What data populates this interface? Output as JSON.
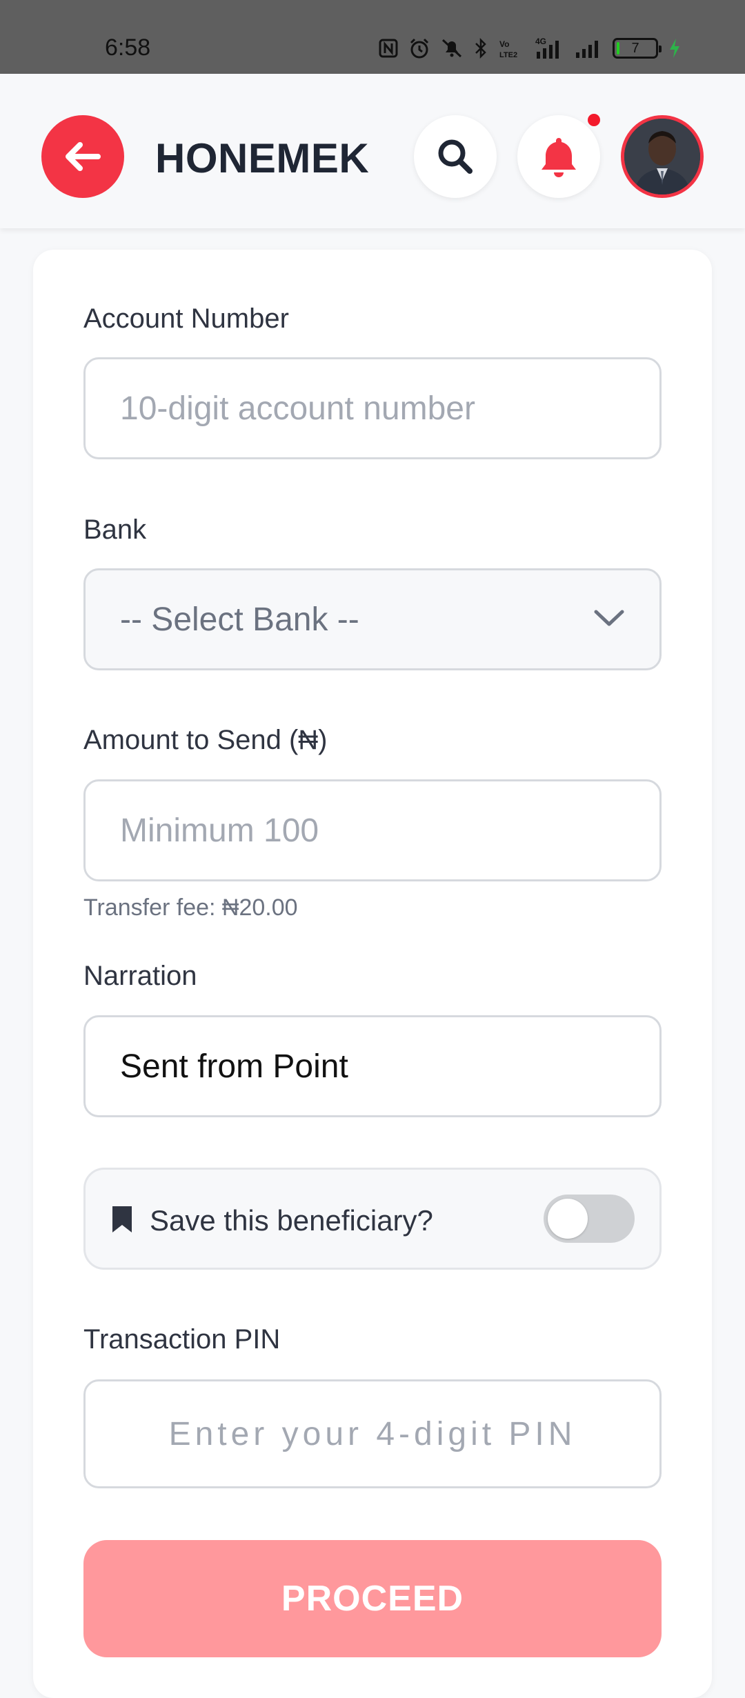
{
  "status_bar": {
    "time": "6:58",
    "battery_level": "7",
    "battery_fraction": 0.07,
    "icons": [
      "nfc-icon",
      "alarm-icon",
      "mute-icon",
      "bluetooth-icon",
      "volte-icon",
      "signal-4g-icon",
      "signal-icon",
      "battery-icon",
      "charging-icon"
    ]
  },
  "header": {
    "title": "HONEMEK",
    "accent_color": "#f33445"
  },
  "form": {
    "account_number": {
      "label": "Account Number",
      "placeholder": "10-digit account number",
      "value": ""
    },
    "bank": {
      "label": "Bank",
      "selected": "-- Select Bank --"
    },
    "amount": {
      "label": "Amount to Send (₦)",
      "placeholder": "Minimum 100",
      "fee_text": "Transfer fee: ₦20.00"
    },
    "narration": {
      "label": "Narration",
      "value": "Sent from Point"
    },
    "save_beneficiary": {
      "label": "Save this beneficiary?",
      "enabled": false
    },
    "pin": {
      "label": "Transaction PIN",
      "placeholder": "Enter your 4-digit PIN"
    },
    "proceed_label": "PROCEED"
  }
}
